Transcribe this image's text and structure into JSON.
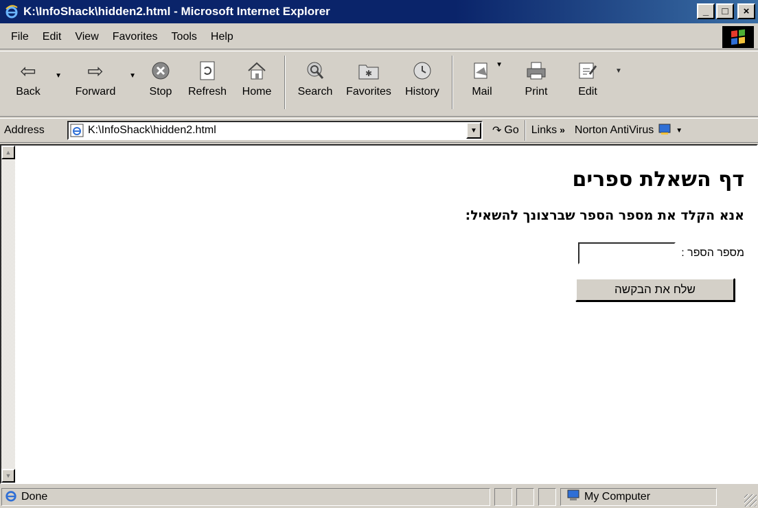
{
  "window": {
    "title": "K:\\InfoShack\\hidden2.html - Microsoft Internet Explorer",
    "controls": {
      "minimize": "_",
      "maximize": "□",
      "close": "×"
    }
  },
  "menu": [
    "File",
    "Edit",
    "View",
    "Favorites",
    "Tools",
    "Help"
  ],
  "toolbar": {
    "back": "Back",
    "forward": "Forward",
    "stop": "Stop",
    "refresh": "Refresh",
    "home": "Home",
    "search": "Search",
    "favorites": "Favorites",
    "history": "History",
    "mail": "Mail",
    "print": "Print",
    "edit": "Edit"
  },
  "address": {
    "label": "Address",
    "url": "K:\\InfoShack\\hidden2.html",
    "go": "Go",
    "links": "Links",
    "norton": "Norton AntiVirus"
  },
  "page": {
    "heading": "דף השאלת ספרים",
    "subheading": "אנא הקלד את מספר הספר שברצונך להשאיל:",
    "field_label": "מספר הספר :",
    "field_value": "",
    "submit_label": "שלח את הבקשה"
  },
  "status": {
    "text": "Done",
    "zone": "My Computer"
  },
  "colors": {
    "titlebar": "#0a246a",
    "chrome": "#d4d0c8"
  }
}
